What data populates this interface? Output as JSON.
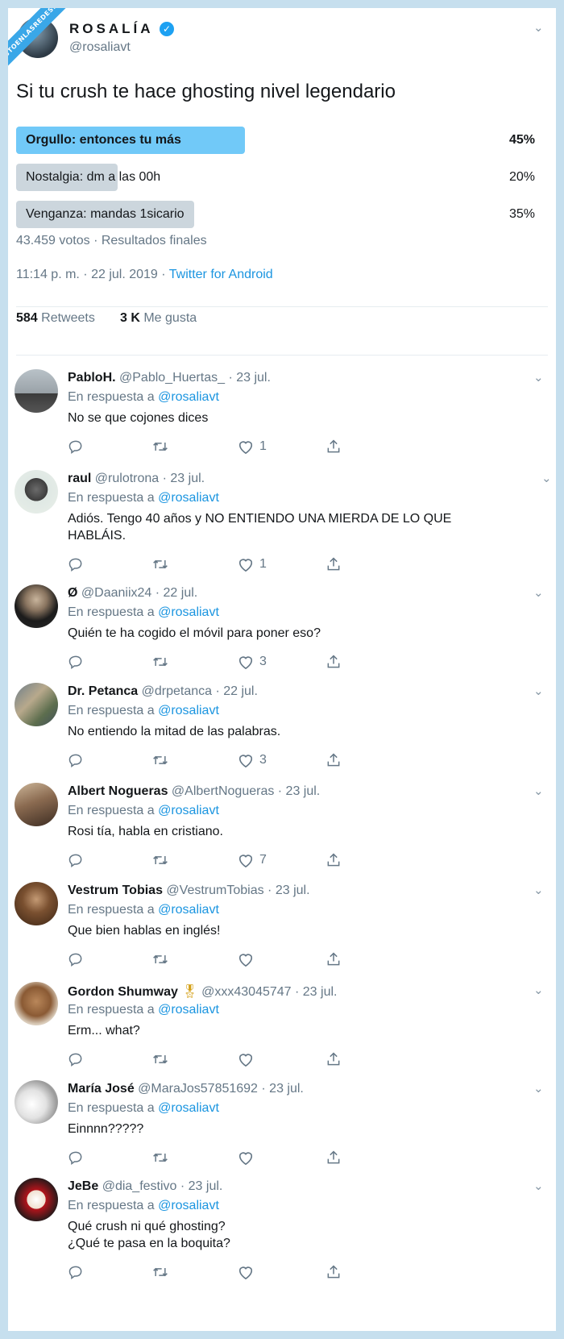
{
  "watermark": "VISTOENLASREDES.com",
  "tweet": {
    "display_name": "ROSALÍA",
    "handle": "@rosaliavt",
    "text": "Si tu crush te hace ghosting nivel legendario",
    "poll": [
      {
        "label": "Orgullo: entonces tu más",
        "percent_text": "45%",
        "percent": 45,
        "winner": true
      },
      {
        "label": "Nostalgia: dm a las 00h",
        "percent_text": "20%",
        "percent": 20,
        "winner": false
      },
      {
        "label": "Venganza: mandas 1sicario",
        "percent_text": "35%",
        "percent": 35,
        "winner": false
      }
    ],
    "poll_meta": "43.459 votos · Resultados finales",
    "time": "11:14 p. m. · 22 jul. 2019 · ",
    "source": "Twitter for Android",
    "retweets_count": "584",
    "retweets_label": "Retweets",
    "likes_count": "3 K",
    "likes_label": "Me gusta"
  },
  "in_reply_prefix": "En respuesta a ",
  "in_reply_mention": "@rosaliavt",
  "replies": [
    {
      "name": "PabloH.",
      "meta": "@Pablo_Huertas_ · 23 jul.",
      "lines": [
        "No se que cojones dices"
      ],
      "likes": "1"
    },
    {
      "name": "raul",
      "meta": "@rulotrona · 23 jul.",
      "lines": [
        "Adiós. Tengo 40 años y NO ENTIENDO UNA MIERDA DE LO QUE",
        "HABLÁIS."
      ],
      "likes": "1"
    },
    {
      "name": "Ø",
      "meta": "@Daaniix24 · 22 jul.",
      "lines": [
        "Quién te ha cogido el móvil para poner eso?"
      ],
      "likes": "3"
    },
    {
      "name": "Dr. Petanca",
      "meta": "@drpetanca · 22 jul.",
      "lines": [
        "No entiendo la mitad de las palabras."
      ],
      "likes": "3"
    },
    {
      "name": "Albert Nogueras",
      "meta": "@AlbertNogueras · 23 jul.",
      "lines": [
        "Rosi tía, habla en cristiano."
      ],
      "likes": "7"
    },
    {
      "name": "Vestrum Tobias",
      "meta": "@VestrumTobias · 23 jul.",
      "lines": [
        "Que bien hablas en inglés!"
      ],
      "likes": ""
    },
    {
      "name": "Gordon Shumway",
      "meta": "@xxx43045747 · 23 jul.",
      "lines": [
        "Erm... what?"
      ],
      "likes": ""
    },
    {
      "name": "María José",
      "meta": "@MaraJos57851692 · 23 jul.",
      "lines": [
        "Einnnn?????"
      ],
      "likes": ""
    },
    {
      "name": "JeBe",
      "meta": "@dia_festivo · 23 jul.",
      "lines": [
        "Qué crush ni qué ghosting?",
        "¿Qué te pasa en la boquita?"
      ],
      "likes": ""
    }
  ]
}
